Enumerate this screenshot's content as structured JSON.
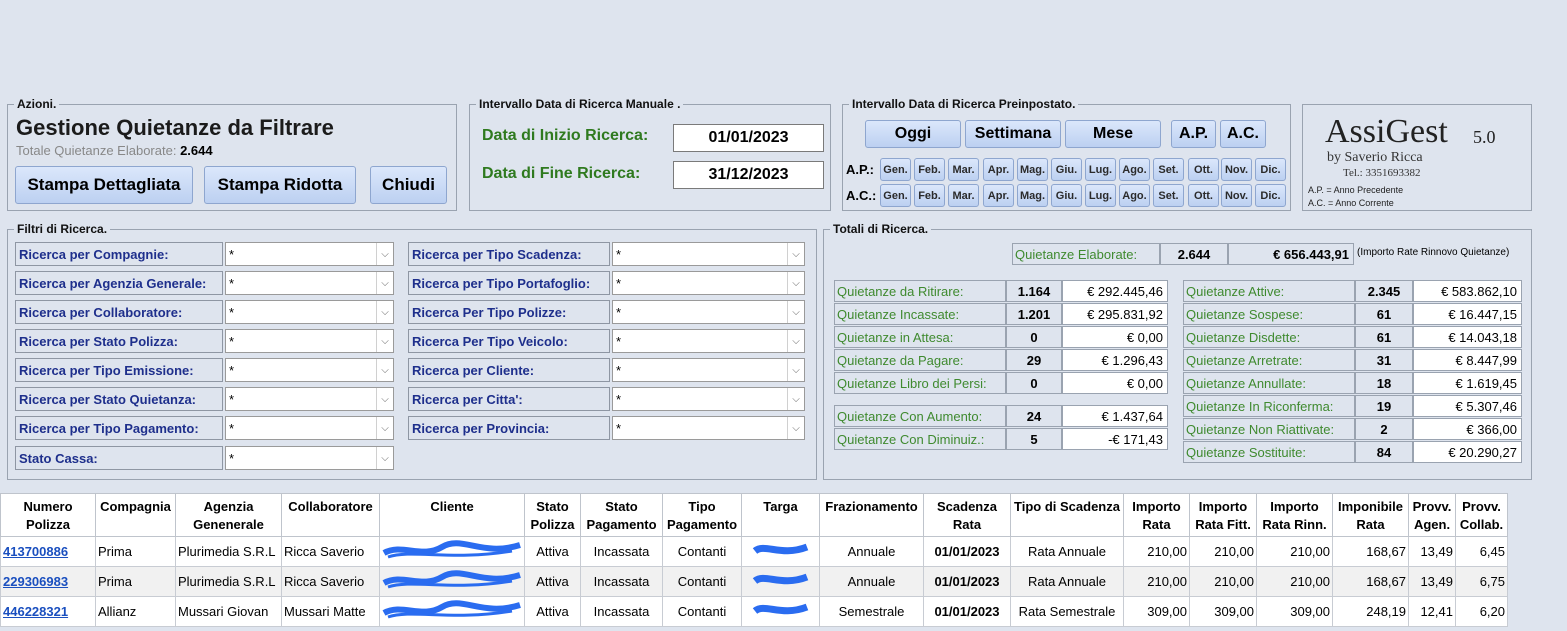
{
  "actions": {
    "legend": "Azioni.",
    "title": "Gestione Quietanze da Filtrare",
    "total_label": "Totale Quietanze Elaborate:",
    "total_value": "2.644",
    "btn_detail": "Stampa Dettagliata",
    "btn_reduced": "Stampa Ridotta",
    "btn_close": "Chiudi"
  },
  "manual": {
    "legend": "Intervallo Data di Ricerca Manuale .",
    "start_label": "Data di Inizio Ricerca:",
    "start_value": "01/01/2023",
    "end_label": "Data di Fine Ricerca:",
    "end_value": "31/12/2023"
  },
  "preset": {
    "legend": "Intervallo Data di Ricerca Preinpostato.",
    "today": "Oggi",
    "week": "Settimana",
    "month": "Mese",
    "ap": "A.P.",
    "ac": "A.C.",
    "ap_row": "A.P.:",
    "ac_row": "A.C.:",
    "months": [
      "Gen.",
      "Feb.",
      "Mar.",
      "Apr.",
      "Mag.",
      "Giu.",
      "Lug.",
      "Ago.",
      "Set.",
      "Ott.",
      "Nov.",
      "Dic."
    ]
  },
  "brand": {
    "name": "AssiGest",
    "version": "5.0",
    "by": "by Saverio Ricca",
    "tel": "Tel.: 3351693382",
    "note1": "A.P. = Anno Precedente",
    "note2": "A.C. = Anno Corrente"
  },
  "filters": {
    "legend": "Filtri di Ricerca.",
    "left": [
      {
        "label": "Ricerca per Compagnie:",
        "value": "*"
      },
      {
        "label": "Ricerca per Agenzia Generale:",
        "value": "*"
      },
      {
        "label": "Ricerca per Collaboratore:",
        "value": "*"
      },
      {
        "label": "Ricerca per Stato Polizza:",
        "value": "*"
      },
      {
        "label": "Ricerca per Tipo Emissione:",
        "value": "*"
      },
      {
        "label": "Ricerca per Stato Quietanza:",
        "value": "*"
      },
      {
        "label": "Ricerca per Tipo Pagamento:",
        "value": "*"
      },
      {
        "label": "Stato Cassa:",
        "value": "*"
      }
    ],
    "right": [
      {
        "label": "Ricerca per Tipo Scadenza:",
        "value": "*"
      },
      {
        "label": "Ricerca per Tipo Portafoglio:",
        "value": "*"
      },
      {
        "label": "Ricerca Per Tipo Polizze:",
        "value": "*"
      },
      {
        "label": "Ricerca Per Tipo Veicolo:",
        "value": "*"
      },
      {
        "label": "Ricerca per Cliente:",
        "value": "*"
      },
      {
        "label": "Ricerca per Citta':",
        "value": "*"
      },
      {
        "label": "Ricerca per Provincia:",
        "value": "*"
      }
    ]
  },
  "totals": {
    "legend": "Totali di Ricerca.",
    "header_label": "Quietanze Elaborate:",
    "header_count": "2.644",
    "header_amount": "€ 656.443,91",
    "header_note": "(Importo Rate Rinnovo Quietanze)",
    "left_a": [
      {
        "label": "Quietanze da Ritirare:",
        "count": "1.164",
        "amount": "€ 292.445,46"
      },
      {
        "label": "Quietanze Incassate:",
        "count": "1.201",
        "amount": "€ 295.831,92"
      },
      {
        "label": "Quietanze in Attesa:",
        "count": "0",
        "amount": "€ 0,00"
      },
      {
        "label": "Quietanze da Pagare:",
        "count": "29",
        "amount": "€ 1.296,43"
      },
      {
        "label": "Quietanze Libro dei Persi:",
        "count": "0",
        "amount": "€ 0,00"
      }
    ],
    "left_b": [
      {
        "label": "Quietanze Con Aumento:",
        "count": "24",
        "amount": "€ 1.437,64"
      },
      {
        "label": "Quietanze Con Diminuiz.:",
        "count": "5",
        "amount": "-€ 171,43"
      }
    ],
    "right": [
      {
        "label": "Quietanze Attive:",
        "count": "2.345",
        "amount": "€ 583.862,10"
      },
      {
        "label": "Quietanze Sospese:",
        "count": "61",
        "amount": "€ 16.447,15"
      },
      {
        "label": "Quietanze Disdette:",
        "count": "61",
        "amount": "€ 14.043,18"
      },
      {
        "label": "Quietanze Arretrate:",
        "count": "31",
        "amount": "€ 8.447,99"
      },
      {
        "label": "Quietanze Annullate:",
        "count": "18",
        "amount": "€ 1.619,45"
      },
      {
        "label": "Quietanze In Riconferma:",
        "count": "19",
        "amount": "€ 5.307,46"
      },
      {
        "label": "Quietanze Non Riattivate:",
        "count": "2",
        "amount": "€ 366,00"
      },
      {
        "label": "Quietanze Sostituite:",
        "count": "84",
        "amount": "€ 20.290,27"
      }
    ]
  },
  "grid": {
    "headers": [
      "Numero Polizza",
      "Compagnia",
      "Agenzia Genenerale",
      "Collaboratore",
      "Cliente",
      "Stato Polizza",
      "Stato Pagamento",
      "Tipo Pagamento",
      "Targa",
      "Frazionamento",
      "Scadenza Rata",
      "Tipo di Scadenza",
      "Importo Rata",
      "Importo Rata Fitt.",
      "Importo Rata Rinn.",
      "Imponibile Rata",
      "Provv. Agen.",
      "Provv. Collab."
    ],
    "rows": [
      [
        "413700886",
        "Prima",
        "Plurimedia S.R.L",
        "Ricca Saverio",
        "",
        "Attiva",
        "Incassata",
        "Contanti",
        "",
        "Annuale",
        "01/01/2023",
        "Rata Annuale",
        "210,00",
        "210,00",
        "210,00",
        "168,67",
        "13,49",
        "6,45"
      ],
      [
        "229306983",
        "Prima",
        "Plurimedia S.R.L",
        "Ricca Saverio",
        "",
        "Attiva",
        "Incassata",
        "Contanti",
        "",
        "Annuale",
        "01/01/2023",
        "Rata Annuale",
        "210,00",
        "210,00",
        "210,00",
        "168,67",
        "13,49",
        "6,75"
      ],
      [
        "446228321",
        "Allianz",
        "Mussari Giovan",
        "Mussari Matte",
        "",
        "Attiva",
        "Incassata",
        "Contanti",
        "",
        "Semestrale",
        "01/01/2023",
        "Rata Semestrale",
        "309,00",
        "309,00",
        "309,00",
        "248,19",
        "12,41",
        "6,20"
      ]
    ]
  }
}
